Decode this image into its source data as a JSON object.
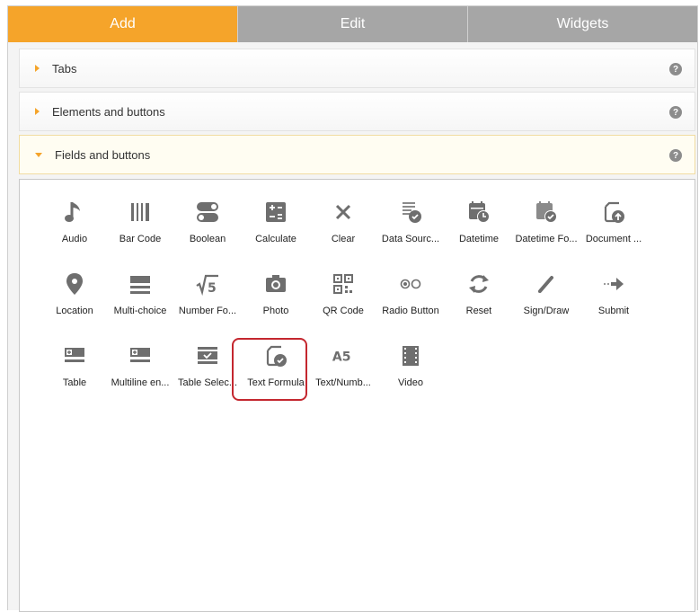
{
  "tabs": [
    {
      "label": "Add",
      "active": true
    },
    {
      "label": "Edit",
      "active": false
    },
    {
      "label": "Widgets",
      "active": false
    }
  ],
  "sections": [
    {
      "label": "Tabs",
      "expanded": false,
      "help": "?"
    },
    {
      "label": "Elements and buttons",
      "expanded": false,
      "help": "?"
    },
    {
      "label": "Fields and buttons",
      "expanded": true,
      "help": "?"
    }
  ],
  "fields": {
    "row1": [
      {
        "label": "Audio",
        "icon": "audio-icon"
      },
      {
        "label": "Bar Code",
        "icon": "barcode-icon"
      },
      {
        "label": "Boolean",
        "icon": "boolean-icon"
      },
      {
        "label": "Calculate",
        "icon": "calculate-icon"
      },
      {
        "label": "Clear",
        "icon": "clear-icon"
      },
      {
        "label": "Data Sourc...",
        "icon": "data-source-icon"
      },
      {
        "label": "Datetime",
        "icon": "datetime-icon"
      },
      {
        "label": "Datetime Fo...",
        "icon": "datetime-formula-icon"
      },
      {
        "label": "Document ...",
        "icon": "document-icon"
      }
    ],
    "row2": [
      {
        "label": "Location",
        "icon": "location-icon"
      },
      {
        "label": "Multi-choice",
        "icon": "multi-choice-icon"
      },
      {
        "label": "Number Fo...",
        "icon": "number-formula-icon"
      },
      {
        "label": "Photo",
        "icon": "photo-icon"
      },
      {
        "label": "QR Code",
        "icon": "qr-code-icon"
      },
      {
        "label": "Radio Button",
        "icon": "radio-button-icon"
      },
      {
        "label": "Reset",
        "icon": "reset-icon"
      },
      {
        "label": "Sign/Draw",
        "icon": "sign-draw-icon"
      },
      {
        "label": "Submit",
        "icon": "submit-icon"
      }
    ],
    "row3": [
      {
        "label": "Table",
        "icon": "table-icon"
      },
      {
        "label": "Multiline en...",
        "icon": "multiline-entry-icon"
      },
      {
        "label": "Table Selec...",
        "icon": "table-select-icon"
      },
      {
        "label": "Text Formula",
        "icon": "text-formula-icon",
        "highlighted": true
      },
      {
        "label": "Text/Numb...",
        "icon": "text-number-icon",
        "glyph": "A5"
      },
      {
        "label": "Video",
        "icon": "video-icon"
      }
    ]
  },
  "colors": {
    "accent": "#f5a42a",
    "tab_inactive": "#a6a6a6",
    "icon": "#6e6e6e",
    "highlight": "#c4272f"
  }
}
